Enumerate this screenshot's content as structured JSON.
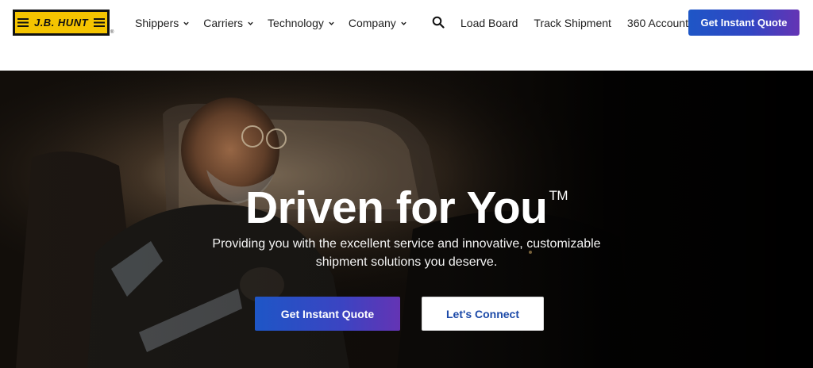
{
  "logo": {
    "text": "J.B. HUNT",
    "registered": "®"
  },
  "nav": {
    "items": [
      {
        "label": "Shippers"
      },
      {
        "label": "Carriers"
      },
      {
        "label": "Technology"
      },
      {
        "label": "Company"
      }
    ]
  },
  "search": {
    "icon": "search-icon"
  },
  "links": {
    "load_board": "Load Board",
    "track_shipment": "Track Shipment",
    "account": "360 Account"
  },
  "header_cta": "Get Instant Quote",
  "hero": {
    "title": "Driven for You",
    "trademark": "TM",
    "subtitle": "Providing you with the excellent service and innovative, customizable shipment solutions you deserve.",
    "primary_cta": "Get Instant Quote",
    "secondary_cta": "Let's Connect"
  },
  "colors": {
    "brand_yellow": "#f5c400",
    "cta_gradient_start": "#1e56c6",
    "cta_gradient_end": "#6434b4",
    "secondary_text": "#1c4aa8"
  }
}
